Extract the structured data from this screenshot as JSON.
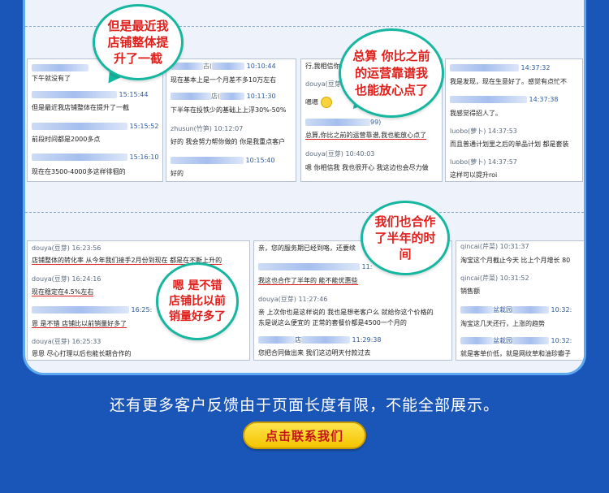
{
  "bubbles": {
    "b1": "但是最近我店铺整体提升了一截",
    "b2": "总算 你比之前的运营靠谱我也能放心点了",
    "b3": "我们也合作了半年的时间",
    "b4": "嗯 是不错店铺比以前销量好多了"
  },
  "shots": {
    "s1": {
      "r1": "下午就没有了",
      "t2": "15:15:44",
      "r3": "但是最近我店铺整体在提升了一截",
      "t4": "15:15:52",
      "r5": "前段时间都是2000多点",
      "t6": "15:16:10",
      "r7": "现在在3500-4000多这样徘徊的"
    },
    "s2": {
      "t1": "10:10:44",
      "m1": "古(",
      "r2": "现在基本上是一个月差不多10万左右",
      "m3": "店(",
      "t3": "10:11:30",
      "r4": "下半年在投铁少的基础上上浮30%-50%",
      "m5": "zhusun(竹笋) 10:12:07",
      "r6": "好的 我会努力帮你做的 你是我重点客户",
      "t7": "10:15:40",
      "r8": "好的"
    },
    "s3": {
      "r1": "行,我相信你",
      "m2": "douya(豆芽) 10:",
      "r3": "嗯嗯",
      "m4": "99)",
      "r5": "总算,你比之前的运营靠谱,我也能放心点了",
      "m6": "douya(豆芽) 10:40:03",
      "r7": "嗯 你相信我 我也很开心 我这边也会尽力做"
    },
    "s4": {
      "t1": "14:37:32",
      "r2": "我是发现，现在生意好了。感觉有点忙不",
      "t3": "14:37:38",
      "r4": "我感觉得招人了。",
      "m5": "luobo(萝卜) 14:37:53",
      "r6": "而且普通计划里之后的单品计划 都是套装",
      "m7": "luobo(萝卜) 14:37:57",
      "r8": "这样可以提升roi"
    },
    "s5": {
      "m1": "douya(豆芽) 16:23:56",
      "r2": "店铺整体的转化率 从今年我们接手2月份到现在 都是在不断上升的",
      "m3": "douya(豆芽) 16:24:16",
      "r4": "现在稳定在4.5%左右",
      "t5": "16:25:",
      "r6": "恩 是不错 店铺比以前销量好多了",
      "m7": "douya(豆芽) 16:25:33",
      "r8": "恩恩 尽心打理以后也能长期合作的"
    },
    "s6": {
      "r1": "亲，您的服务期已经到咯，还要续",
      "t2": "11:",
      "r3": "我这也合作了半年的 能不能优惠些",
      "m4": "douya(豆芽) 11:27:46",
      "r5": "亲 上次你也是这样说的 我也是想老客户么 就给你这个价格的",
      "r6": "东是说这么便宜的 正常的套餐价都是4500一个月的",
      "m7": "店",
      "t7": "11:29:38",
      "r8": "您把合同做出来 我们这边明天付款过去"
    },
    "s7": {
      "m1": "qincai(芹菜) 10:31:37",
      "r2": "淘宝这个月截止今天  比上个月增长 80",
      "m3": "qincai(芹菜) 10:31:52",
      "r4": "销售额",
      "m5": "盆栽园",
      "t5": "10:32:",
      "r6": "淘宝这几天还行，上涨的趋势",
      "m7": "盆栽园",
      "t7": "10:32:",
      "r8": "就是客单价低，就是网纹草和油珍瓣子"
    }
  },
  "footer": {
    "message": "还有更多客户反馈由于页面长度有限，不能全部展示。",
    "cta_label": "点击联系我们"
  },
  "colors": {
    "background": "#1a55b8",
    "bubble_border": "#16b7a0",
    "bubble_text": "#e0201c",
    "cta_bg": "#f4c400",
    "cta_text": "#c2161b"
  }
}
